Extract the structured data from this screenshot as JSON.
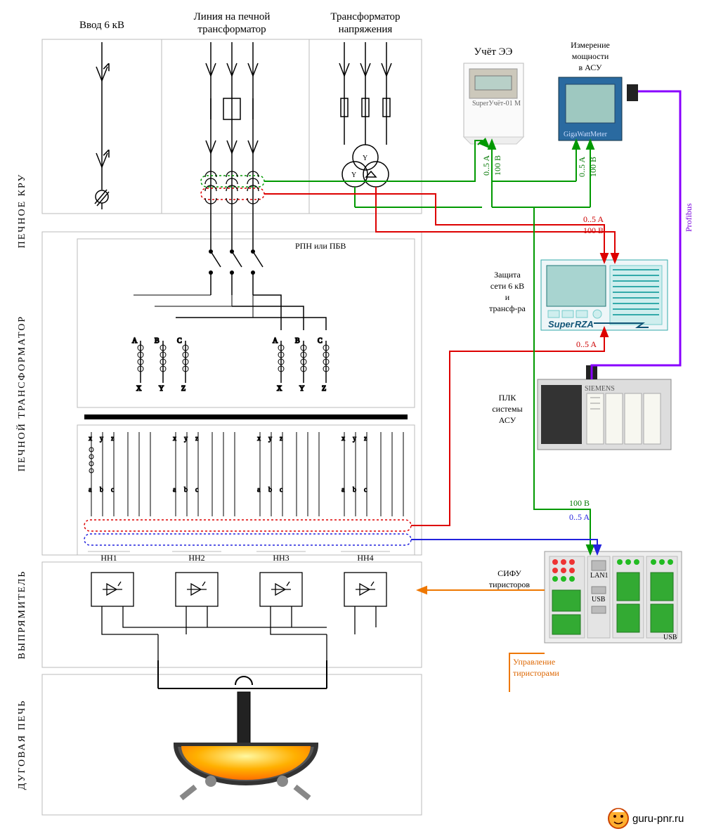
{
  "rows": {
    "kru": "ПЕЧНОЕ КРУ",
    "trans": "ПЕЧНОЙ ТРАНСФОРМАТОР",
    "rect": "ВЫПРЯМИТЕЛЬ",
    "furnace": "ДУГОВАЯ ПЕЧЬ"
  },
  "top": {
    "input": "Ввод 6 кВ",
    "line": "Линия на печной\nтрансформатор",
    "vt": "Трансформатор\nнапряжения"
  },
  "labels": {
    "rpn": "РПН или ПБВ",
    "hv": {
      "a": "A",
      "b": "B",
      "c": "C",
      "x": "X",
      "y": "Y",
      "z": "Z"
    },
    "nn": [
      "НН1",
      "НН2",
      "НН3",
      "НН4"
    ],
    "lv_letters": [
      "x",
      "y",
      "z",
      "a",
      "b",
      "c"
    ],
    "ee": "Учёт ЭЭ",
    "power": "Измерение\nмощности\nв АСУ",
    "meter_brand": "SuperУчёт-01 М",
    "pm_brand": "GigaWattMeter",
    "protection": "Защита\nсети 6 кВ\nи\nтрансф-ра",
    "relay_brand1": "Super",
    "relay_brand2": "RZA",
    "plc": "ПЛК\nсистемы\nАСУ",
    "plc_brand": "SIEMENS",
    "sifu": "СИФУ\nтиристоров",
    "sifu_ctrl": "Управление\nтиристорами",
    "profibus": "Profibus",
    "lan": "LAN1",
    "usb": "USB"
  },
  "signals": {
    "i_05": "0..5 A",
    "v_100": "100 В"
  },
  "footer": {
    "site": "guru-pnr.ru"
  }
}
